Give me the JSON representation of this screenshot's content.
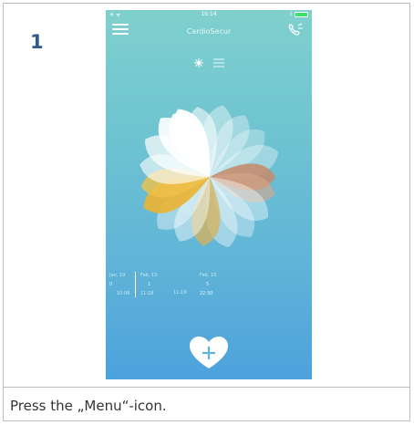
{
  "step": {
    "number": "1",
    "caption": "Press the „Menu“-icon."
  },
  "status_bar": {
    "time": "16:14",
    "left_icons": "airplane-icon wifi-icon",
    "right_icons": "bluetooth-icon battery-icon"
  },
  "app": {
    "title": "CardioSecur",
    "menu_icon": "hamburger-menu-icon",
    "phone_icon": "phone-icon"
  },
  "view_toggle": {
    "active": "flower-view-icon",
    "inactive": "list-view-icon"
  },
  "timeline": [
    {
      "date": "Jan. 19",
      "count": "0",
      "time": "10:06"
    },
    {
      "date": "Feb. 15",
      "count": "1",
      "time": "11:18"
    },
    {
      "date": "",
      "count": "",
      "time": "11:19"
    },
    {
      "date": "Feb. 15",
      "count": "5",
      "time": "22:30"
    }
  ],
  "add_button": {
    "icon": "heart-plus-icon"
  },
  "colors": {
    "bg_top": "#7fd0cd",
    "bg_bottom": "#4ca2dc",
    "accent_yellow": "#e7b73c",
    "accent_brown": "#c59070",
    "step_number": "#2f5a8c"
  }
}
